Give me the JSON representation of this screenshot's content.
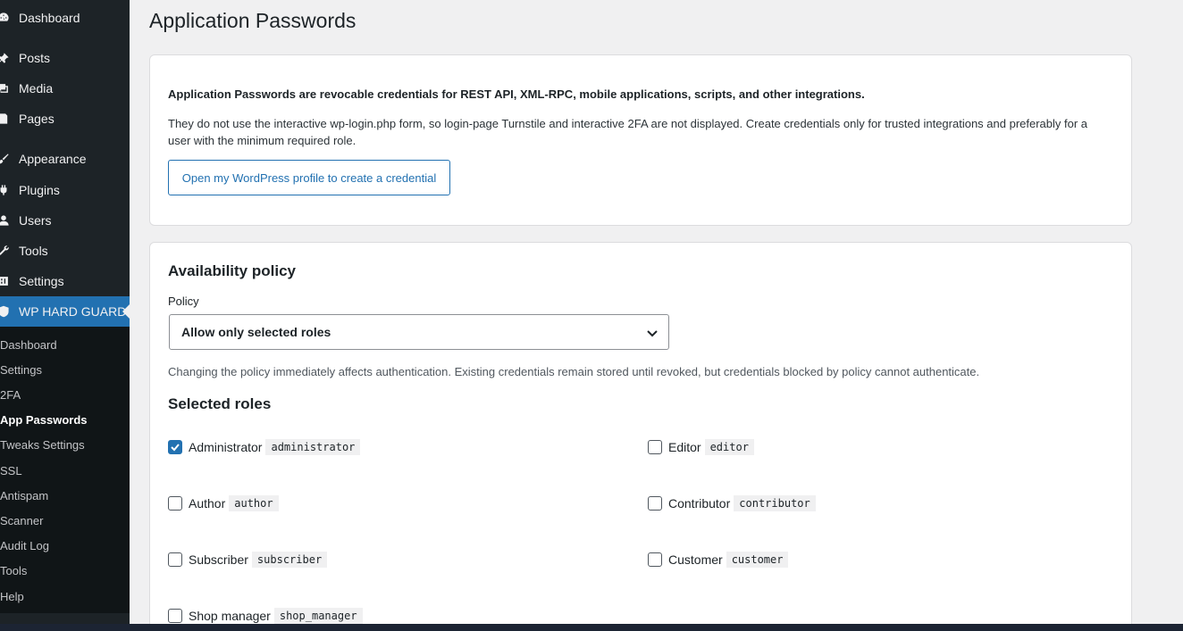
{
  "sidebar": {
    "items": [
      {
        "label": "Dashboard",
        "icon": "dashboard-icon"
      },
      {
        "label": "Posts",
        "icon": "pin-icon"
      },
      {
        "label": "Media",
        "icon": "media-icon"
      },
      {
        "label": "Pages",
        "icon": "pages-icon"
      },
      {
        "label": "Appearance",
        "icon": "brush-icon"
      },
      {
        "label": "Plugins",
        "icon": "plugin-icon"
      },
      {
        "label": "Users",
        "icon": "user-icon"
      },
      {
        "label": "Tools",
        "icon": "wrench-icon"
      },
      {
        "label": "Settings",
        "icon": "settings-icon"
      },
      {
        "label": "WP HARD GUARD",
        "icon": "shield-icon"
      }
    ],
    "submenu": [
      "Dashboard",
      "Settings",
      "2FA",
      "App Passwords",
      "Tweaks Settings",
      "SSL",
      "Antispam",
      "Scanner",
      "Audit Log",
      "Tools",
      "Help"
    ]
  },
  "page": {
    "title": "Application Passwords"
  },
  "intro": {
    "strong": "Application Passwords are revocable credentials for REST API, XML-RPC, mobile applications, scripts, and other integrations.",
    "text": "They do not use the interactive wp-login.php form, so login-page Turnstile and interactive 2FA are not displayed. Create credentials only for trusted integrations and preferably for a user with the minimum required role.",
    "button": "Open my WordPress profile to create a credential"
  },
  "policy": {
    "title": "Availability policy",
    "label": "Policy",
    "selected": "Allow only selected roles",
    "help": "Changing the policy immediately affects authentication. Existing credentials remain stored until revoked, but credentials blocked by policy cannot authenticate."
  },
  "roles": {
    "title": "Selected roles",
    "items": [
      {
        "name": "Administrator",
        "slug": "administrator",
        "checked": true
      },
      {
        "name": "Editor",
        "slug": "editor",
        "checked": false
      },
      {
        "name": "Author",
        "slug": "author",
        "checked": false
      },
      {
        "name": "Contributor",
        "slug": "contributor",
        "checked": false
      },
      {
        "name": "Subscriber",
        "slug": "subscriber",
        "checked": false
      },
      {
        "name": "Customer",
        "slug": "customer",
        "checked": false
      },
      {
        "name": "Shop manager",
        "slug": "shop_manager",
        "checked": false
      }
    ]
  },
  "colors": {
    "accent": "#2271b1",
    "sidebar": "#1d2327",
    "submenu": "#101517"
  }
}
